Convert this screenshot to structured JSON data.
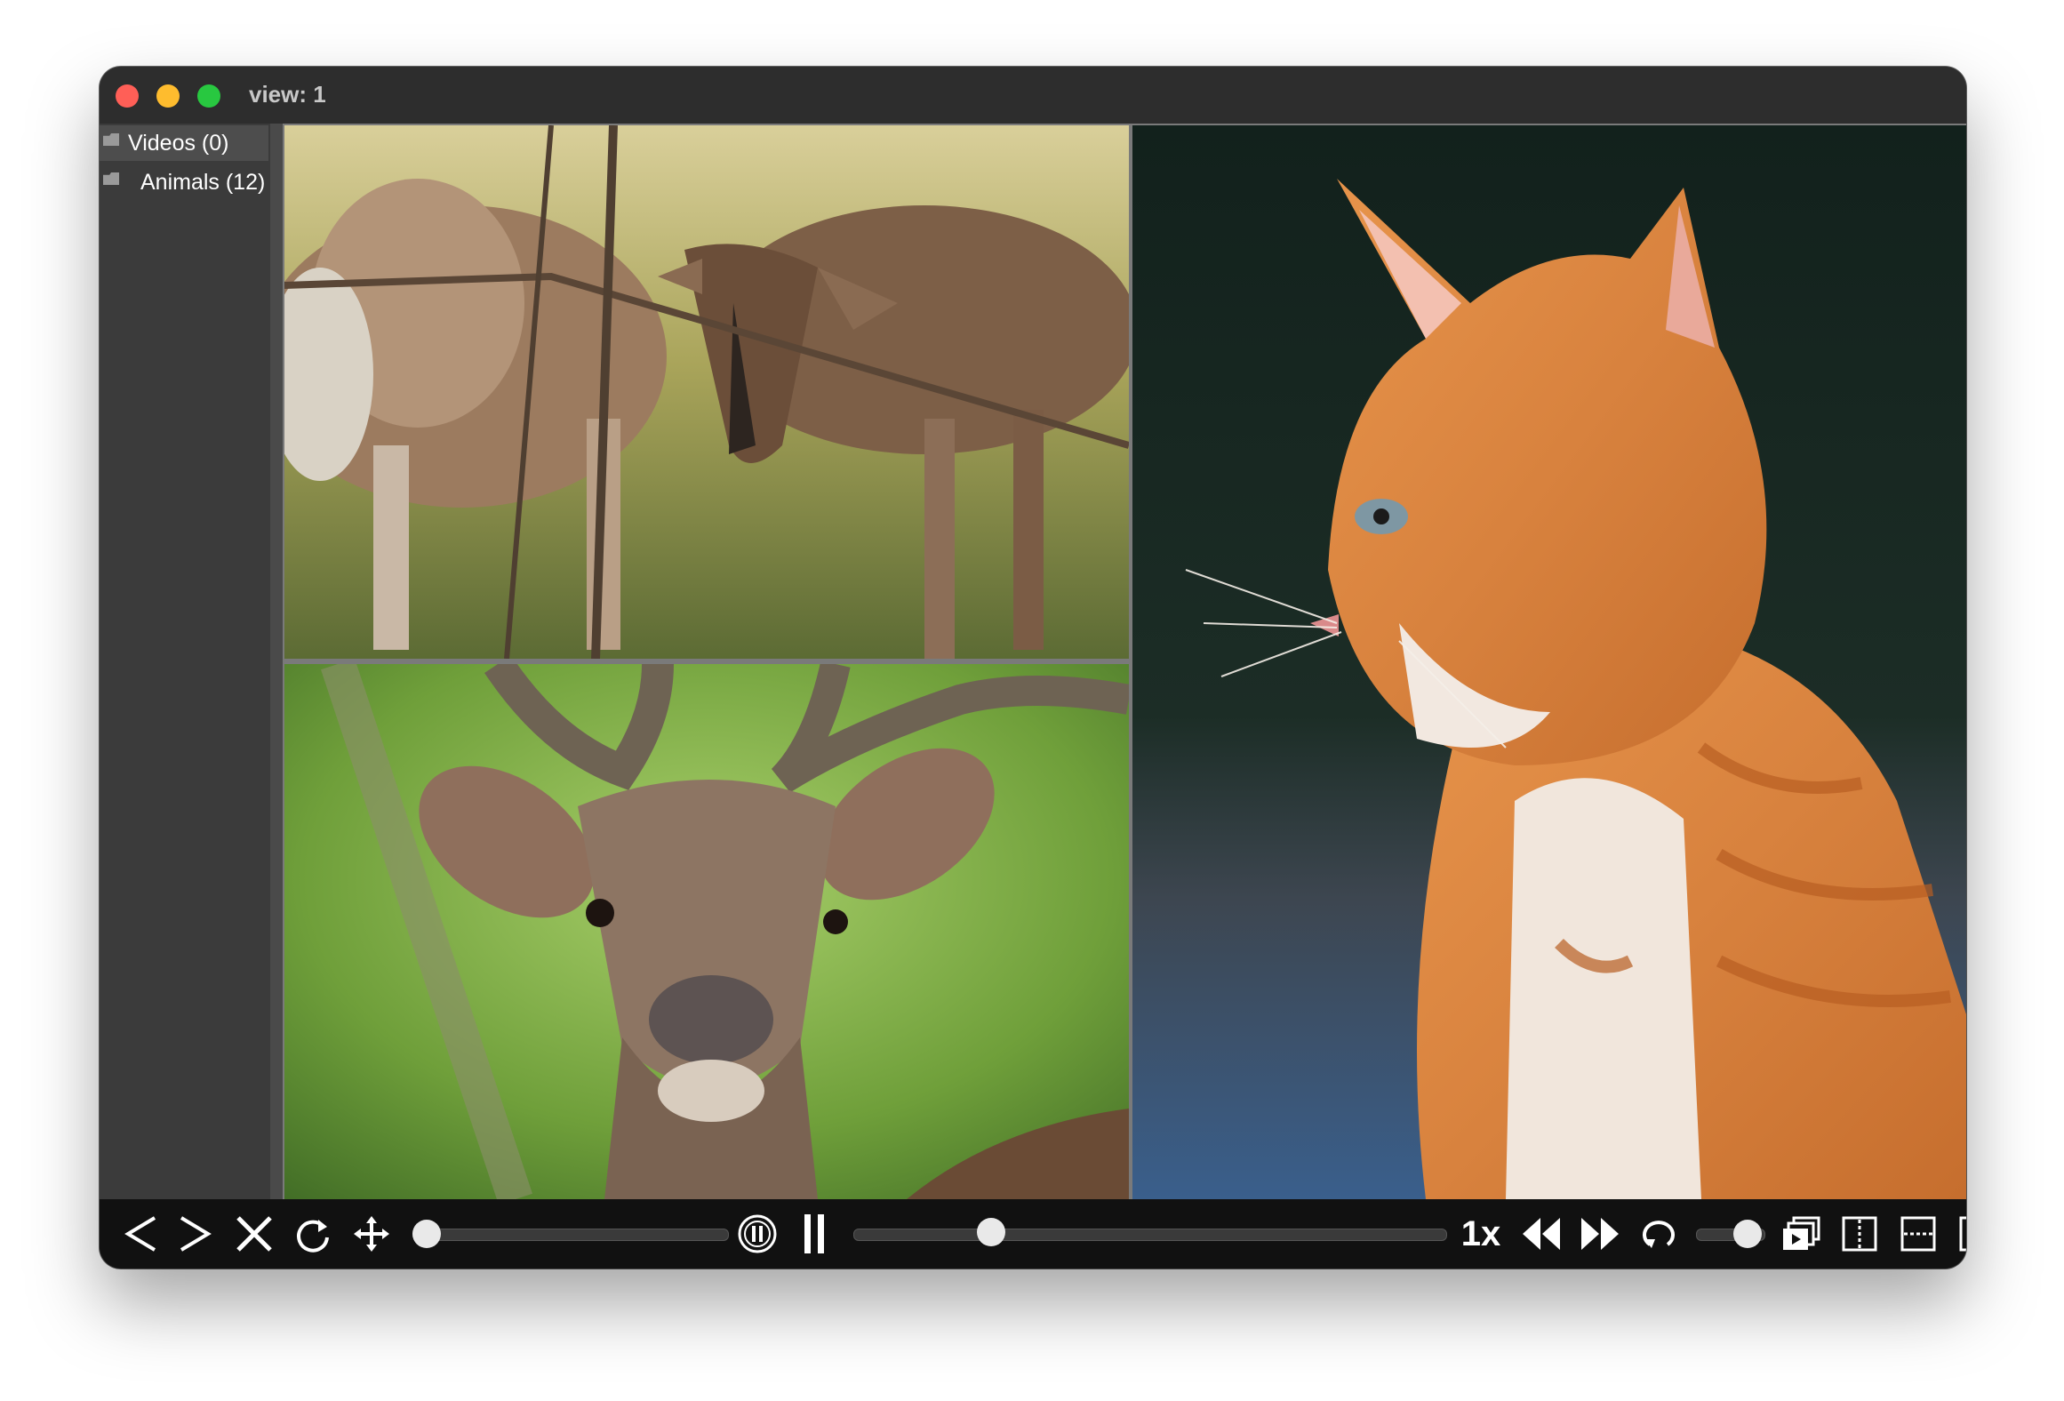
{
  "window": {
    "title": "view: 1"
  },
  "sidebar": {
    "items": [
      {
        "label": "Videos (0)",
        "selected": true
      },
      {
        "label": "Animals (12)",
        "selected": false
      }
    ]
  },
  "media": {
    "panes": [
      {
        "subject": "goats"
      },
      {
        "subject": "deer"
      },
      {
        "subject": "kitten"
      }
    ]
  },
  "toolbar": {
    "speed_label": "1x",
    "icons": [
      "previous-icon",
      "next-icon",
      "close-icon",
      "rotate-icon",
      "move-icon",
      "pause-circle-icon",
      "pause-icon",
      "rewind-icon",
      "fast-forward-icon",
      "loop-icon",
      "window-stack-icon",
      "split-vertical-icon",
      "split-horizontal-icon",
      "close-pane-icon",
      "help-icon"
    ],
    "sliders": {
      "left_progress": 0.0,
      "main_progress": 0.22,
      "volume": 0.95
    }
  }
}
